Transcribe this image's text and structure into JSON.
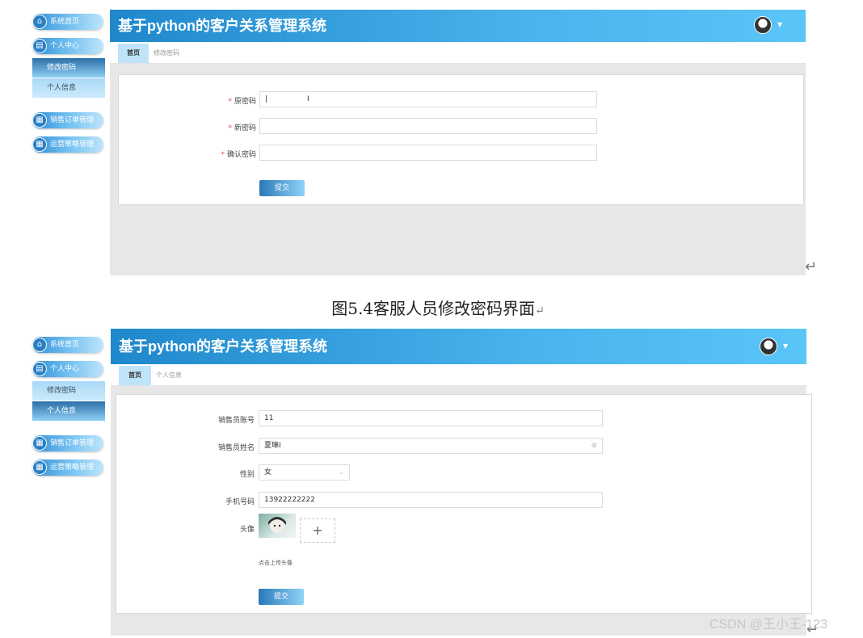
{
  "app": {
    "title": "基于python的客户关系管理系统"
  },
  "sidebar": {
    "home": "系统首页",
    "personal_center": "个人中心",
    "change_password": "修改密码",
    "personal_info": "个人信息",
    "sales_orders": "销售订单管理",
    "ops_strategy": "运营策略管理"
  },
  "screen1": {
    "tabs": [
      "首页",
      "修改密码"
    ],
    "form": {
      "old_password_label": "原密码",
      "new_password_label": "新密码",
      "confirm_password_label": "确认密码",
      "old_password_value": "|",
      "required_mark": "*"
    },
    "submit": "提交"
  },
  "caption": "图5.4客服人员修改密码界面",
  "return_mark": "↵",
  "screen2": {
    "tabs": [
      "首页",
      "个人信息"
    ],
    "form": {
      "account_label": "销售员账号",
      "account_value": "11",
      "name_label": "销售员姓名",
      "name_value": "夏琳",
      "gender_label": "性别",
      "gender_value": "女",
      "phone_label": "手机号码",
      "phone_value": "13922222222",
      "avatar_label": "头像",
      "upload_plus": "+",
      "upload_hint": "点击上传头像"
    },
    "submit": "提交"
  },
  "watermark": "CSDN @王小王-123",
  "colors": {
    "header_start": "#1f88cc",
    "header_end": "#5ac5f7",
    "active_tab": "#bfe3f8",
    "required": "#e24b3b"
  },
  "icons": {
    "home": "home-icon",
    "personal": "id-card-icon",
    "grid": "grid-icon",
    "text_cursor": "text-cursor-icon",
    "clear": "clear-icon",
    "chevron": "chevron-down-icon"
  }
}
